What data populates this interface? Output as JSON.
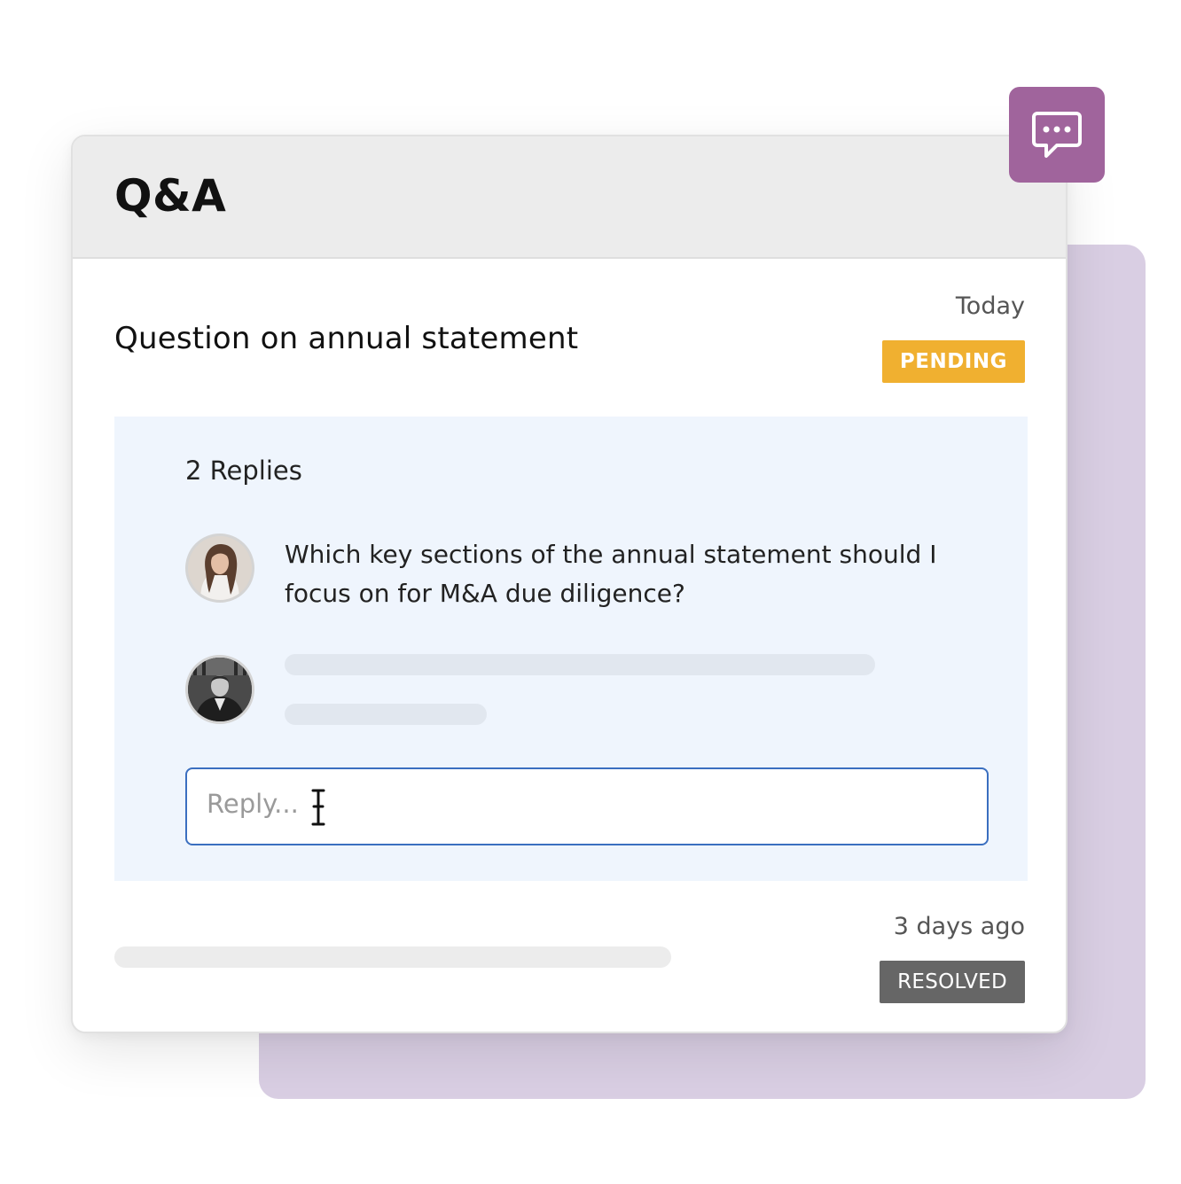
{
  "panel": {
    "title": "Q&A",
    "chat_icon": "chat-bubble-icon"
  },
  "question": {
    "title": "Question on annual statement",
    "date": "Today",
    "status": "PENDING",
    "status_color": "#f0b030"
  },
  "replies": {
    "count_label": "2 Replies",
    "items": [
      {
        "avatar": "avatar-woman",
        "text": "Which key sections of the annual statement should I focus on for M&A due diligence?"
      },
      {
        "avatar": "avatar-man",
        "text": ""
      }
    ],
    "input_placeholder": "Reply..."
  },
  "older_question": {
    "date": "3 days ago",
    "status": "RESOLVED",
    "status_color": "#666666"
  },
  "colors": {
    "accent": "#a0649c",
    "backdrop": "#d9cee3",
    "reply_panel": "#eff5fd",
    "input_border": "#3b6fc0"
  }
}
